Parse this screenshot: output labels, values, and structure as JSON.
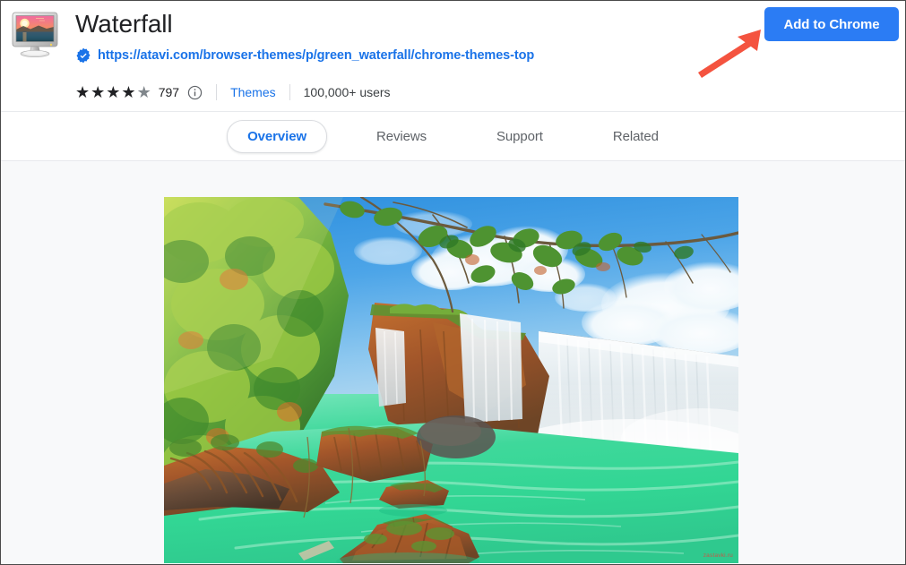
{
  "header": {
    "app_icon_name": "monitor-sunset-icon",
    "title": "Waterfall",
    "verified_badge_name": "verified-badge-icon",
    "url": "https://atavi.com/browser-themes/p/green_waterfall/chrome-themes-top",
    "rating": {
      "stars_filled": 4,
      "stars_total": 5,
      "count": "797",
      "info_icon_name": "info-icon"
    },
    "category": "Themes",
    "users": "100,000+ users",
    "add_button_label": "Add to Chrome",
    "arrow_name": "red-pointer-arrow"
  },
  "tabs": [
    {
      "label": "Overview",
      "active": true
    },
    {
      "label": "Reviews",
      "active": false
    },
    {
      "label": "Support",
      "active": false
    },
    {
      "label": "Related",
      "active": false
    }
  ],
  "main": {
    "screenshot_alt": "waterfall-theme-preview",
    "watermark": "zastavki.ru"
  },
  "colors": {
    "accent_blue": "#1a73e8",
    "button_blue": "#2b7cf4",
    "arrow_red": "#f4533f",
    "page_bg": "#f8f9fa",
    "text_primary": "#202124",
    "text_secondary": "#5f6368"
  }
}
